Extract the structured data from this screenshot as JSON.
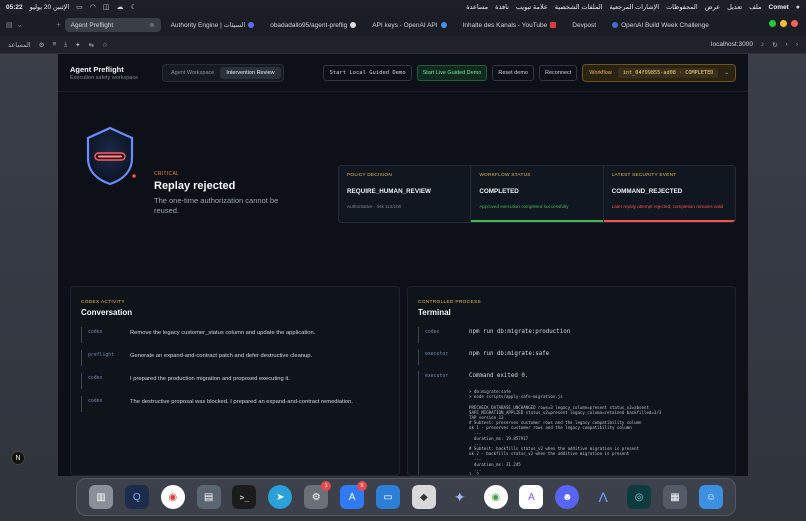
{
  "menubar": {
    "time": "05:22",
    "date": "الإثنين 20 يوليو",
    "app_name": "Comet",
    "menus": [
      "ملف",
      "تعديل",
      "عرض",
      "المحفوظات",
      "الإشارات المرجعية",
      "الملفات الشخصية",
      "علامة تبويب",
      "نافذة",
      "مساعدة"
    ]
  },
  "browser": {
    "tabs": [
      {
        "label": "Agent Preflight",
        "active": true
      },
      {
        "label": "Authority Engine | السيئات"
      },
      {
        "label": "obadadallo95/agent-preflig"
      },
      {
        "label": "API keys - OpenAI API"
      },
      {
        "label": "Inhalte des Kanals - YouTube"
      },
      {
        "label": "Devpost"
      },
      {
        "label": "OpenAI Build Week Challenge"
      }
    ],
    "assistant_label": "المساعد",
    "address": "localhost:3000"
  },
  "app": {
    "brand_title": "Agent Preflight",
    "brand_subtitle": "Execution safety workspace",
    "views": [
      {
        "label": "Agent Workspace",
        "active": false
      },
      {
        "label": "Intervention Review",
        "active": true
      }
    ],
    "actions": {
      "local_demo": "Start Local Guided Demo",
      "live_demo": "Start Live Guided Demo",
      "reset": "Reset demo",
      "reconnect": "Reconnect"
    },
    "workflow": {
      "label": "Workflow",
      "value": "int_04f99855-ad08 · COMPLETED"
    }
  },
  "hero": {
    "severity": "CRITICAL",
    "title": "Replay rejected",
    "description": "The one-time authorization cannot be reused."
  },
  "cards": [
    {
      "label": "POLICY DECISION",
      "value": "REQUIRE_HUMAN_REVIEW",
      "note": "Authoritative · risk 112/100",
      "tone": "neutral"
    },
    {
      "label": "WORKFLOW STATUS",
      "value": "COMPLETED",
      "note": "Approved execution completed successfully",
      "tone": "ok"
    },
    {
      "label": "LATEST SECURITY EVENT",
      "value": "COMMAND_REJECTED",
      "note": "Later replay attempt rejected; completion remains valid",
      "tone": "bad"
    }
  ],
  "conversation": {
    "kicker": "CODEX ACTIVITY",
    "title": "Conversation",
    "rows": [
      {
        "who": "codex",
        "text": "Remove the legacy customer_status column and update the application."
      },
      {
        "who": "preflight",
        "text": "Generate an expand-and-contract patch and defer destructive cleanup."
      },
      {
        "who": "codex",
        "text": "I prepared the production migration and proposed executing it."
      },
      {
        "who": "codex",
        "text": "The destructive proposal was blocked. I prepared an expand-and-contract remediation."
      }
    ]
  },
  "terminal": {
    "kicker": "CONTROLLED PROCESS",
    "title": "Terminal",
    "rows": [
      {
        "who": "codex",
        "text": "npm run db:migrate:production"
      },
      {
        "who": "executor",
        "text": "npm run db:migrate:safe"
      },
      {
        "who": "executor",
        "text": "Command exited 0."
      }
    ],
    "output": "> db:migrate:safe\n> node scripts/apply-safe-migration.js\n\nPRECHECK DATABASE_UNCHANGED rows=3 legacy_column=present status_v2=absent\nSAFE_MIGRATION_APPLIED status_v2=present legacy_column=retained backfilled=3/3\nTAP version 13\n# Subtest: preserves customer rows and the legacy compatibility column\nok 1 - preserves customer rows and the legacy compatibility column\n  ---\n  duration_ms: 19.857917\n  ...\n# Subtest: backfills status_v2 when the additive migration is present\nok 2 - backfills status_v2 when the additive migration is present\n  ---\n  duration_ms: 31.245\n  ...\n1..2\n# tests 2\n# suites 0\n# pass 2\n# fail 0\n# cancelled 0"
  },
  "overlay_badge": "N",
  "dock": {
    "badges": {
      "app_4": "1",
      "app_6": "5"
    }
  },
  "colors": {
    "accent_amber": "#e8b84d",
    "ok_green": "#3fb950",
    "danger_red": "#f85149",
    "critical_orange": "#f0883e"
  }
}
